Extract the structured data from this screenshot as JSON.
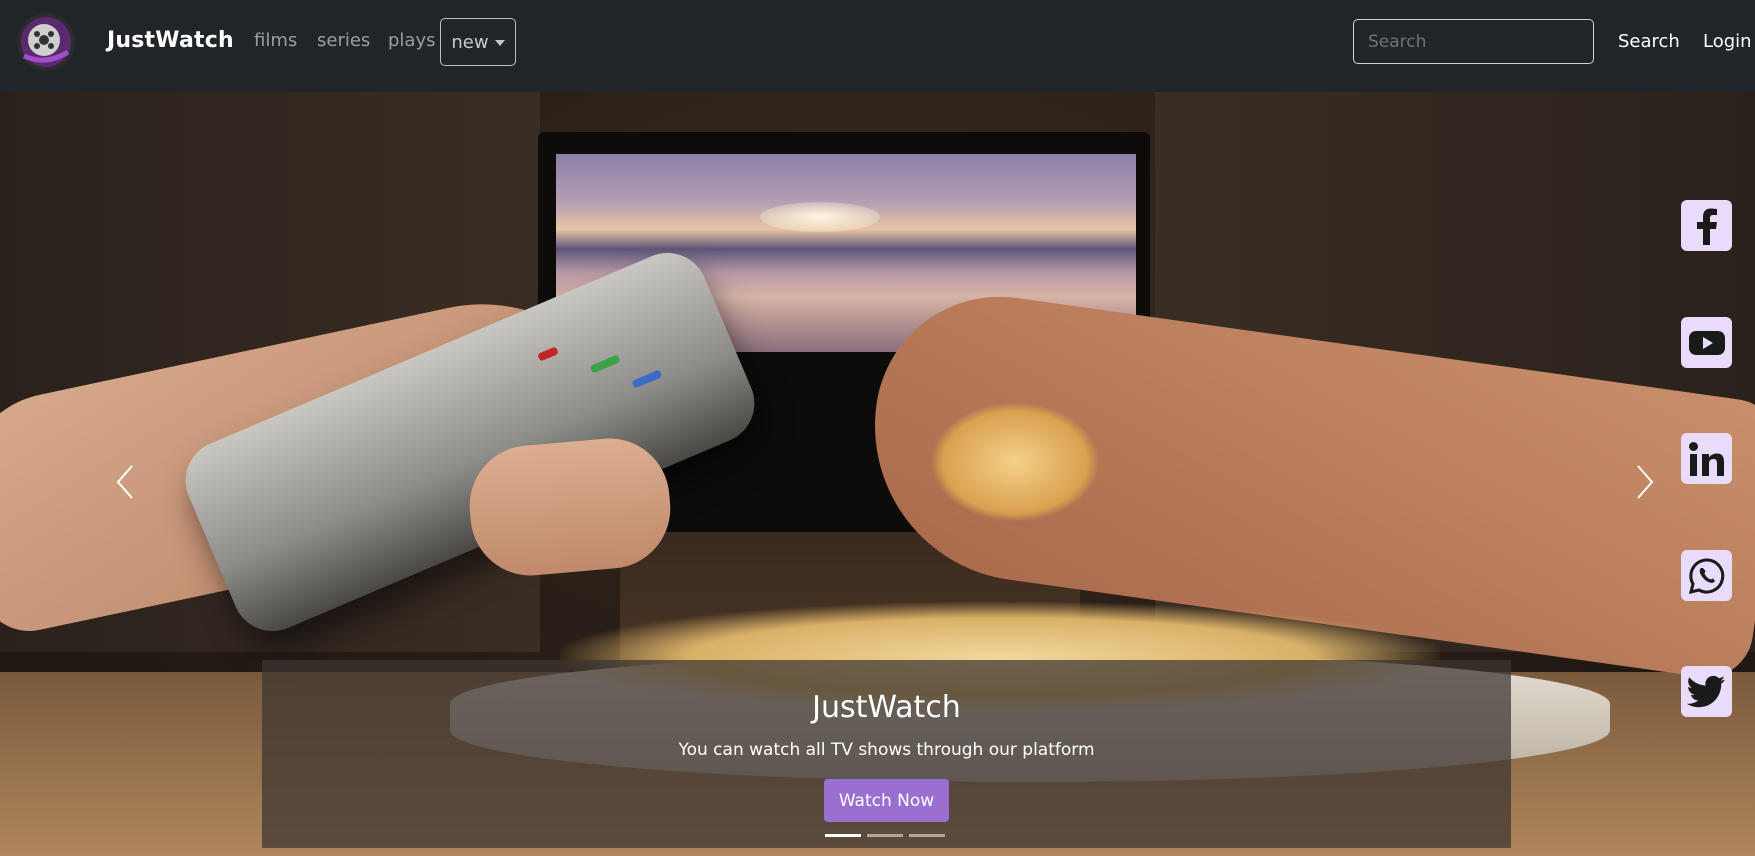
{
  "navbar": {
    "brand": "JustWatch",
    "links": [
      "films",
      "series",
      "plays"
    ],
    "dropdown_label": "new",
    "search_placeholder": "Search",
    "search_button": "Search",
    "login": "Login"
  },
  "hero": {
    "caption_title": "JustWatch",
    "caption_subtitle": "You can watch all TV shows through our platform",
    "cta_label": "Watch Now",
    "slides": 3,
    "active_slide": 1
  },
  "social": [
    "facebook-icon",
    "youtube-icon",
    "linkedin-icon",
    "whatsapp-icon",
    "twitter-icon"
  ],
  "colors": {
    "navbar_bg": "#212529",
    "accent": "#9b6fd2",
    "social_bg": "#e9dcfb",
    "social_fg": "#1a1a1a"
  }
}
